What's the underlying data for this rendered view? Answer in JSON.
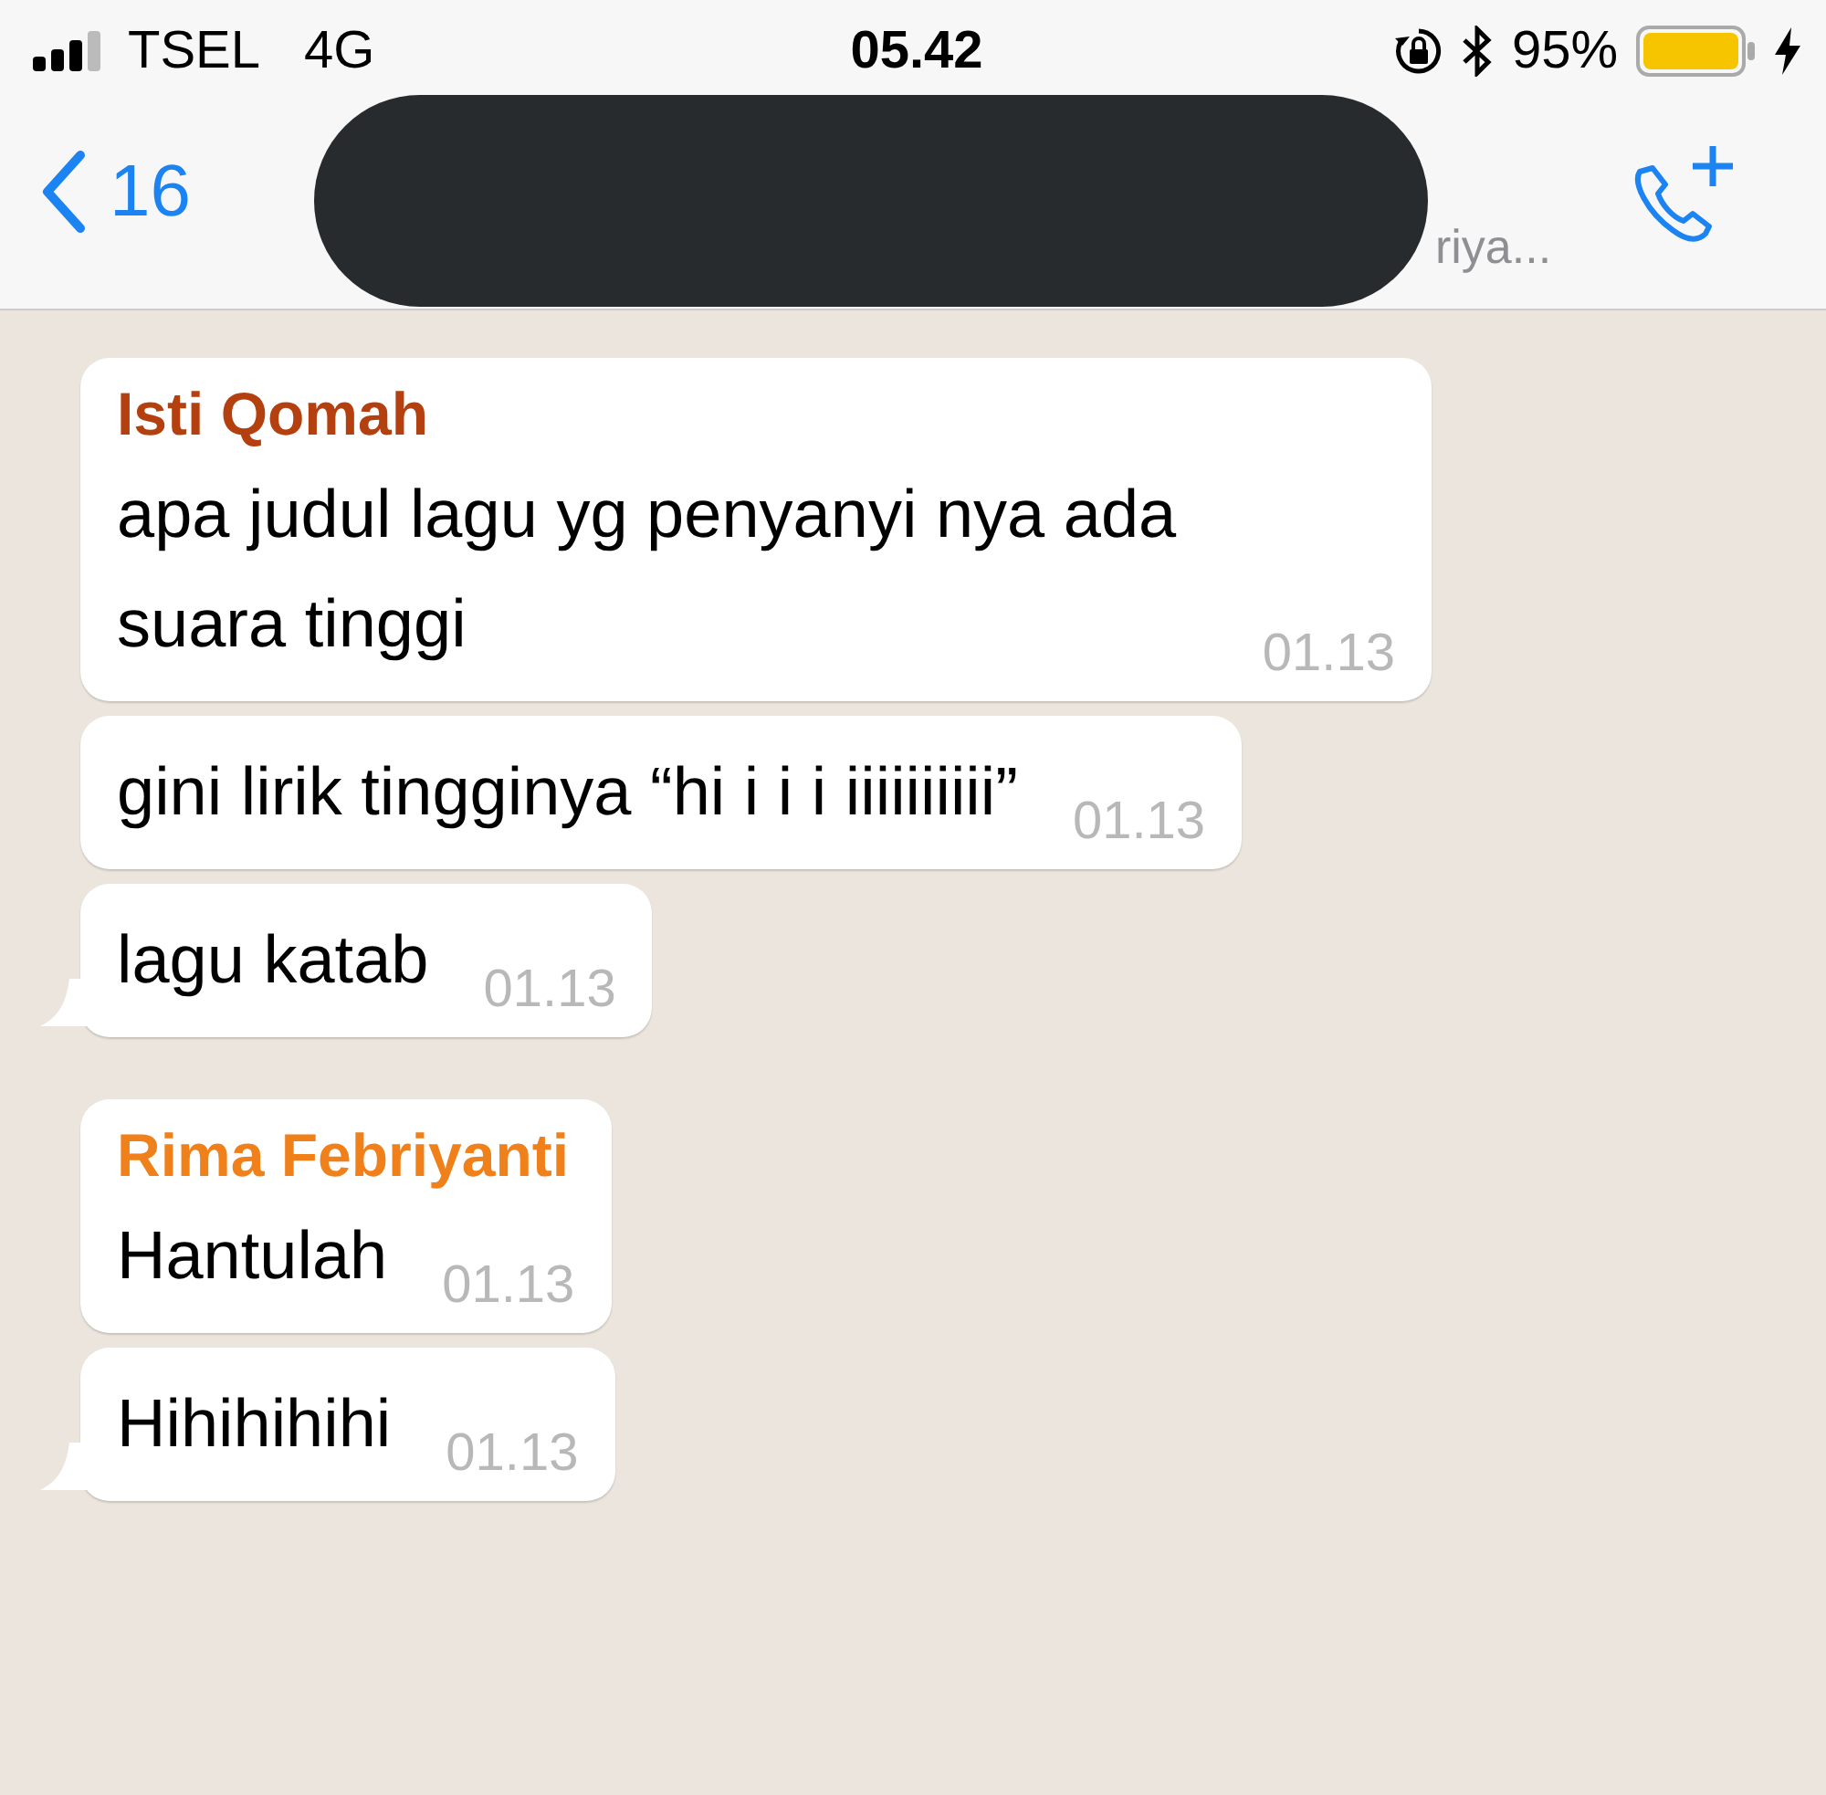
{
  "status_bar": {
    "carrier": "TSEL",
    "network": "4G",
    "time": "05.42",
    "battery": "95%"
  },
  "nav_bar": {
    "back_label": "16",
    "subtitle": "riya..."
  },
  "messages": [
    {
      "sender": "Isti Qomah",
      "color": "#b5400f",
      "text": "apa judul lagu yg penyanyi nya ada suara tinggi",
      "time": "01.13",
      "tail": false
    },
    {
      "text": "gini lirik tingginya “hi i i i iiiiiiiiii”",
      "time": "01.13",
      "tail": false
    },
    {
      "text": "lagu katab",
      "time": "01.13",
      "tail": true
    },
    {
      "sender": "Rima Febriyanti",
      "color": "#f0801a",
      "text": "Hantulah",
      "time": "01.13",
      "tail": false
    },
    {
      "text": "Hihihihihi",
      "time": "01.13",
      "tail": true
    }
  ]
}
